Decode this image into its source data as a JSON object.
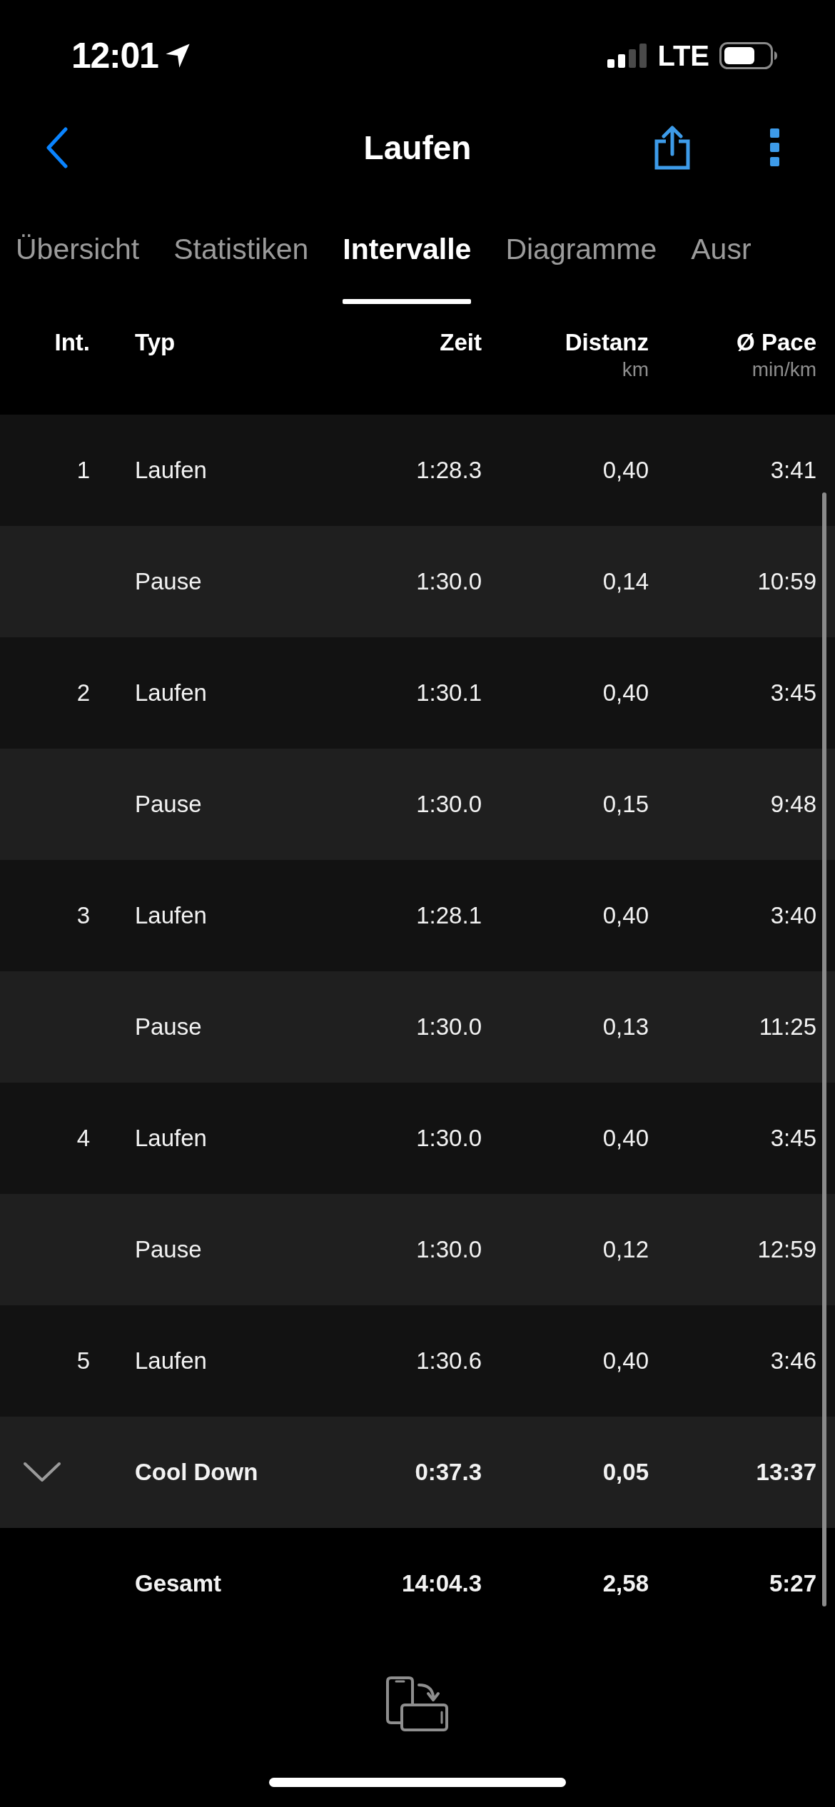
{
  "status_bar": {
    "time": "12:01",
    "network": "LTE"
  },
  "nav": {
    "title": "Laufen"
  },
  "tabs": [
    {
      "label": "Übersicht",
      "selected": false
    },
    {
      "label": "Statistiken",
      "selected": false
    },
    {
      "label": "Intervalle",
      "selected": true
    },
    {
      "label": "Diagramme",
      "selected": false
    },
    {
      "label": "Ausr",
      "selected": false
    }
  ],
  "table": {
    "columns": [
      {
        "label": "Int."
      },
      {
        "label": "Typ"
      },
      {
        "label": "Zeit"
      },
      {
        "label": "Distanz",
        "unit": "km"
      },
      {
        "label": "Ø Pace",
        "unit": "min/km"
      }
    ],
    "rows": [
      {
        "kind": "interval",
        "int": "1",
        "type": "Laufen",
        "time": "1:28.3",
        "distance": "0,40",
        "pace": "3:41"
      },
      {
        "kind": "pause",
        "type": "Pause",
        "time": "1:30.0",
        "distance": "0,14",
        "pace": "10:59"
      },
      {
        "kind": "interval",
        "int": "2",
        "type": "Laufen",
        "time": "1:30.1",
        "distance": "0,40",
        "pace": "3:45"
      },
      {
        "kind": "pause",
        "type": "Pause",
        "time": "1:30.0",
        "distance": "0,15",
        "pace": "9:48"
      },
      {
        "kind": "interval",
        "int": "3",
        "type": "Laufen",
        "time": "1:28.1",
        "distance": "0,40",
        "pace": "3:40"
      },
      {
        "kind": "pause",
        "type": "Pause",
        "time": "1:30.0",
        "distance": "0,13",
        "pace": "11:25"
      },
      {
        "kind": "interval",
        "int": "4",
        "type": "Laufen",
        "time": "1:30.0",
        "distance": "0,40",
        "pace": "3:45"
      },
      {
        "kind": "pause",
        "type": "Pause",
        "time": "1:30.0",
        "distance": "0,12",
        "pace": "12:59"
      },
      {
        "kind": "interval",
        "int": "5",
        "type": "Laufen",
        "time": "1:30.6",
        "distance": "0,40",
        "pace": "3:46"
      },
      {
        "kind": "cooldown",
        "expanded": false,
        "type": "Cool Down",
        "time": "0:37.3",
        "distance": "0,05",
        "pace": "13:37"
      },
      {
        "kind": "total",
        "type": "Gesamt",
        "time": "14:04.3",
        "distance": "2,58",
        "pace": "5:27"
      }
    ]
  }
}
